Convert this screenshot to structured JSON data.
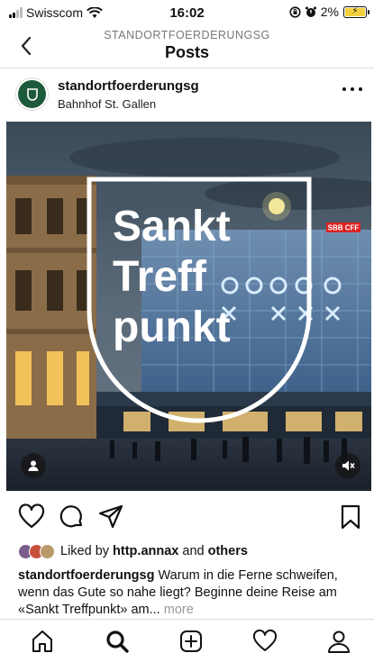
{
  "status_bar": {
    "carrier": "Swisscom",
    "time": "16:02",
    "battery": "2%",
    "battery_level": 0.02
  },
  "nav": {
    "subtitle": "STANDORTFOERDERUNGSG",
    "title": "Posts",
    "back_icon": "chevron-left-icon"
  },
  "post": {
    "username": "standortfoerderungsg",
    "location": "Bahnhof St. Gallen",
    "image_text": [
      "Sankt",
      "Treff",
      "punkt"
    ],
    "sign_text": "SBB CFF"
  },
  "likes": {
    "prefix": "Liked by ",
    "user": "http.annax",
    "and": " and ",
    "others": "others"
  },
  "caption": {
    "username": "standortfoerderungsg",
    "text": " Warum in die Ferne schweifen, wenn das Gute so nahe liegt? Beginne deine Reise am «Sankt Treffpunkt» am",
    "ellipsis": "... ",
    "more": "more"
  },
  "colors": {
    "accent_green": "#1d5a3a",
    "sky": "#4a5a6a"
  },
  "tabbar": [
    "home-icon",
    "search-icon",
    "new-post-icon",
    "activity-heart-icon",
    "profile-icon"
  ]
}
